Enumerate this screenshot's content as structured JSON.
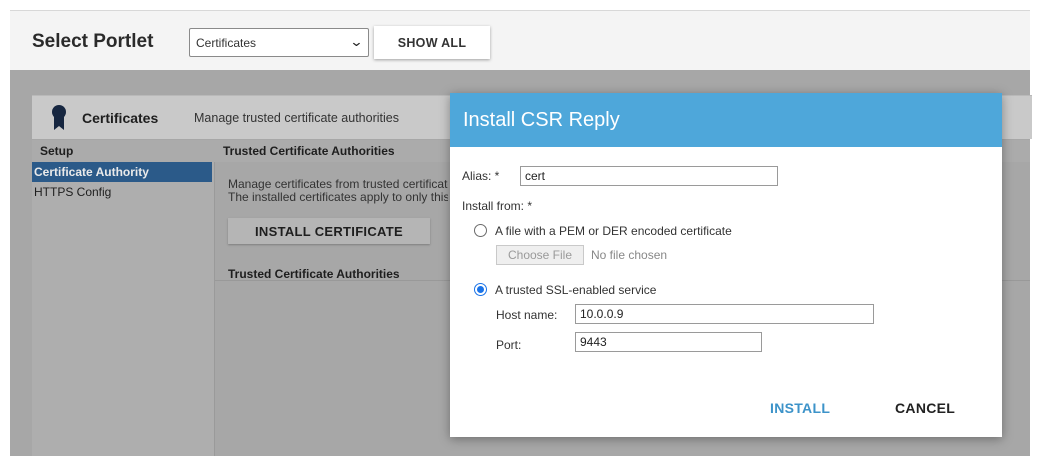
{
  "topbar": {
    "title": "Select Portlet",
    "portlet_select_value": "Certificates",
    "show_all_label": "SHOW ALL"
  },
  "panel": {
    "title": "Certificates",
    "description": "Manage trusted certificate authorities",
    "setup_header": "Setup",
    "content_header": "Trusted Certificate Authorities",
    "sidebar_items": [
      "Certificate Authority",
      "HTTPS Config"
    ],
    "content_line1": "Manage certificates from trusted certificate authorities.",
    "content_line2": "The installed certificates apply to only this node.",
    "install_certificate_label": "INSTALL CERTIFICATE",
    "content_subheader": "Trusted Certificate Authorities"
  },
  "dialog": {
    "title": "Install CSR Reply",
    "alias_label": "Alias: *",
    "alias_value": "cert",
    "install_from_label": "Install from: *",
    "option_file_label": "A file with a PEM or DER encoded certificate",
    "choose_file_label": "Choose File",
    "no_file_text": "No file chosen",
    "option_service_label": "A trusted SSL-enabled service",
    "host_label": "Host name:",
    "host_value": "10.0.0.9",
    "port_label": "Port:",
    "port_value": "9443",
    "install_label": "INSTALL",
    "cancel_label": "CANCEL"
  },
  "colors": {
    "dialog_header": "#4ea7da",
    "install_button": "#3d93c9",
    "sidebar_active": "#2b5a89",
    "radio_checked": "#1a73e8"
  },
  "icons": {
    "panel_icon": "ribbon-badge-icon",
    "select_chevron": "chevron-down-icon"
  }
}
